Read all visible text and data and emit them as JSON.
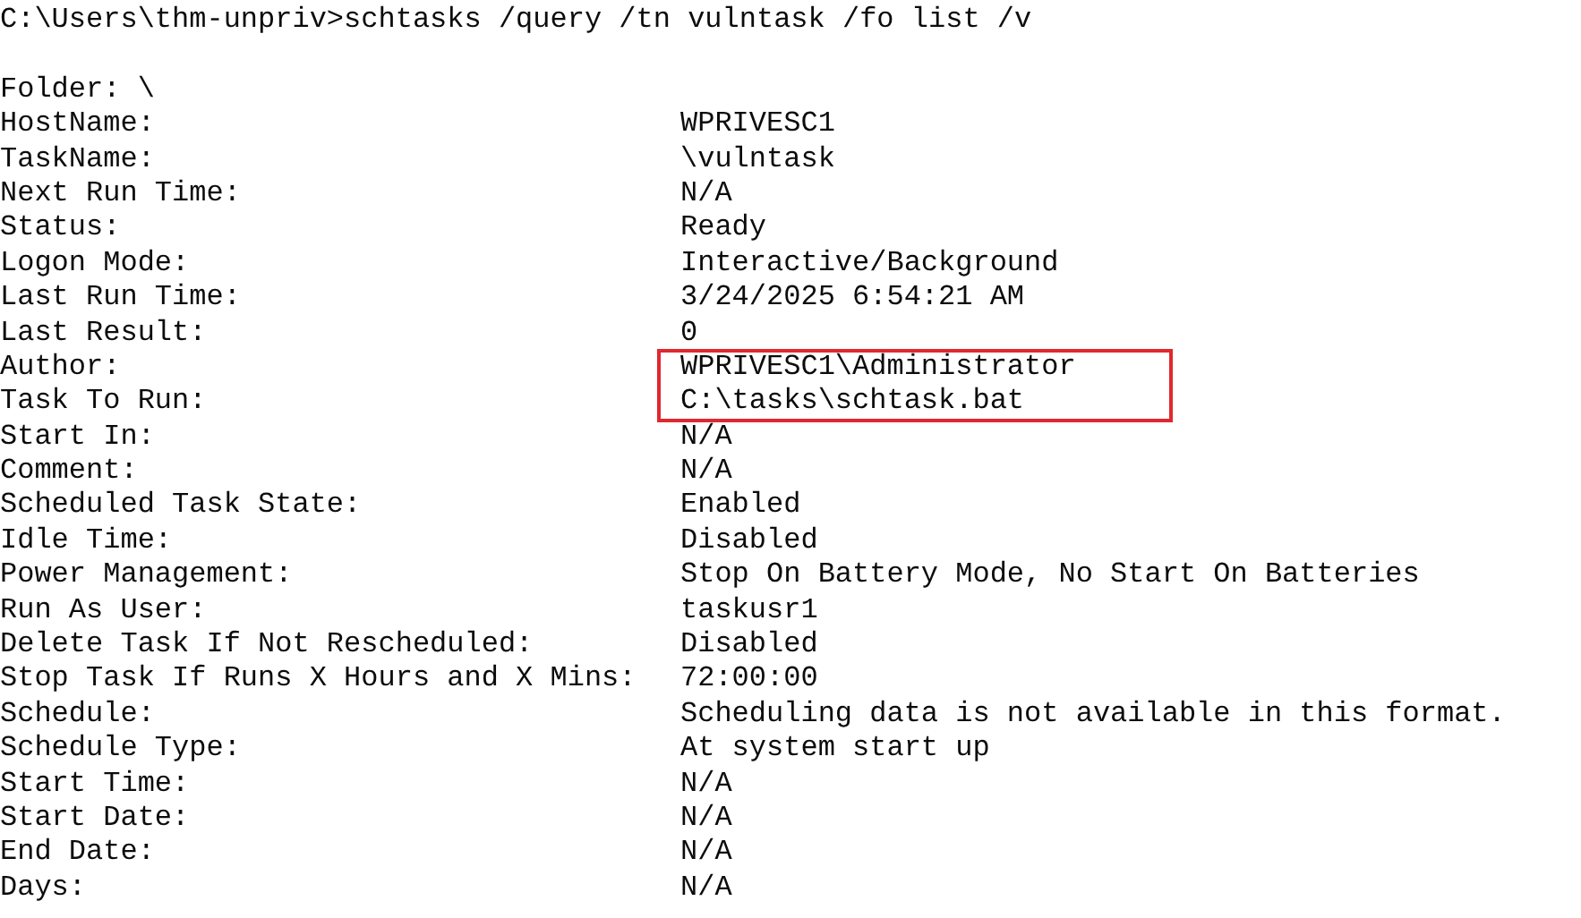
{
  "terminal": {
    "command": "C:\\Users\\thm-unpriv>schtasks /query /tn vulntask /fo list /v",
    "folder": {
      "label": "Folder:",
      "value": "\\"
    },
    "rows": [
      {
        "label": "HostName:",
        "value": "WPRIVESC1",
        "highlighted": false
      },
      {
        "label": "TaskName:",
        "value": "\\vulntask",
        "highlighted": false
      },
      {
        "label": "Next Run Time:",
        "value": "N/A",
        "highlighted": false
      },
      {
        "label": "Status:",
        "value": "Ready",
        "highlighted": false
      },
      {
        "label": "Logon Mode:",
        "value": "Interactive/Background",
        "highlighted": false
      },
      {
        "label": "Last Run Time:",
        "value": "3/24/2025 6:54:21 AM",
        "highlighted": false
      },
      {
        "label": "Last Result:",
        "value": "0",
        "highlighted": false
      },
      {
        "label": "Author:",
        "value": "WPRIVESC1\\Administrator",
        "highlighted": true
      },
      {
        "label": "Task To Run:",
        "value": "C:\\tasks\\schtask.bat",
        "highlighted": true
      },
      {
        "label": "Start In:",
        "value": "N/A",
        "highlighted": false
      },
      {
        "label": "Comment:",
        "value": "N/A",
        "highlighted": false
      },
      {
        "label": "Scheduled Task State:",
        "value": "Enabled",
        "highlighted": false
      },
      {
        "label": "Idle Time:",
        "value": "Disabled",
        "highlighted": false
      },
      {
        "label": "Power Management:",
        "value": "Stop On Battery Mode, No Start On Batteries",
        "highlighted": false
      },
      {
        "label": "Run As User:",
        "value": "taskusr1",
        "highlighted": false
      },
      {
        "label": "Delete Task If Not Rescheduled:",
        "value": "Disabled",
        "highlighted": false
      },
      {
        "label": "Stop Task If Runs X Hours and X Mins:",
        "value": "72:00:00",
        "highlighted": false
      },
      {
        "label": "Schedule:",
        "value": "Scheduling data is not available in this format.",
        "highlighted": false
      },
      {
        "label": "Schedule Type:",
        "value": "At system start up",
        "highlighted": false
      },
      {
        "label": "Start Time:",
        "value": "N/A",
        "highlighted": false
      },
      {
        "label": "Start Date:",
        "value": "N/A",
        "highlighted": false
      },
      {
        "label": "End Date:",
        "value": "N/A",
        "highlighted": false
      },
      {
        "label": "Days:",
        "value": "N/A",
        "highlighted": false
      }
    ]
  }
}
